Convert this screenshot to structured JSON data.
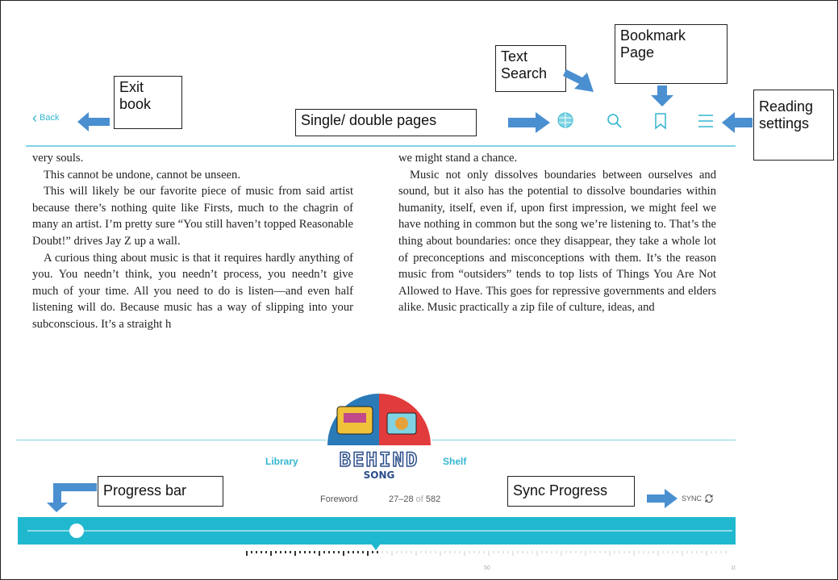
{
  "header": {
    "back_label": "Back",
    "icons": [
      "globe-icon",
      "search-icon",
      "bookmark-icon",
      "menu-icon"
    ]
  },
  "callouts": {
    "exit_book": "Exit\nbook",
    "single_double": "Single/ double pages",
    "text_search": "Text\nSearch",
    "bookmark_page": "Bookmark\nPage",
    "reading_settings": "Reading\nsettings",
    "progress_bar": "Progress bar",
    "sync_progress": "Sync Progress"
  },
  "left_page": {
    "paragraphs": [
      {
        "text": "very souls.",
        "indent": false
      },
      {
        "text": "This cannot be undone, cannot be unseen.",
        "indent": true
      },
      {
        "text": "This will likely be our favorite piece of music from said artist because there’s nothing quite like Firsts, much to the chagrin of many an artist. I’m pretty sure “You still haven’t topped Reasonable Doubt!” drives Jay Z up a wall.",
        "indent": true
      },
      {
        "text": "A curious thing about music is that it requires hardly anything of you. You needn’t think, you needn’t process, you needn’t give much of your time. All you need to do is listen—and even half listening will do. Because music has a way of slipping into your subconscious. It’s a straight h",
        "indent": true
      }
    ]
  },
  "right_page": {
    "paragraphs": [
      {
        "text": "we might stand a chance.",
        "indent": false
      },
      {
        "text": "Music not only dissolves boundaries between ourselves and sound, but it also has the potential to dissolve boundaries within humanity, itself, even if, upon first impression, we might feel we have nothing in common but the song we’re listening to. That’s the thing about boundaries: once they disappear, they take a whole lot of preconceptions and misconceptions with them. It’s the reason music from “outsiders” tends to top lists of Things You Are Not Allowed to Have. This goes for repressive governments and elders alike. Music practically a zip file of culture, ideas, and",
        "indent": true
      }
    ]
  },
  "bottom": {
    "library_label": "Library",
    "shelf_label": "Shelf",
    "book_logo": "BEHIND SONG",
    "chapter": "Foreword",
    "pages": "27–28",
    "of_label": "of",
    "total_pages": "582",
    "sync_label": "SYNC",
    "progress_fraction": 0.05,
    "scale_labels": [
      "50",
      "10"
    ]
  },
  "colors": {
    "accent": "#33b6d0",
    "progress_bar": "#20b8cf",
    "arrow": "#4a8fd0"
  }
}
